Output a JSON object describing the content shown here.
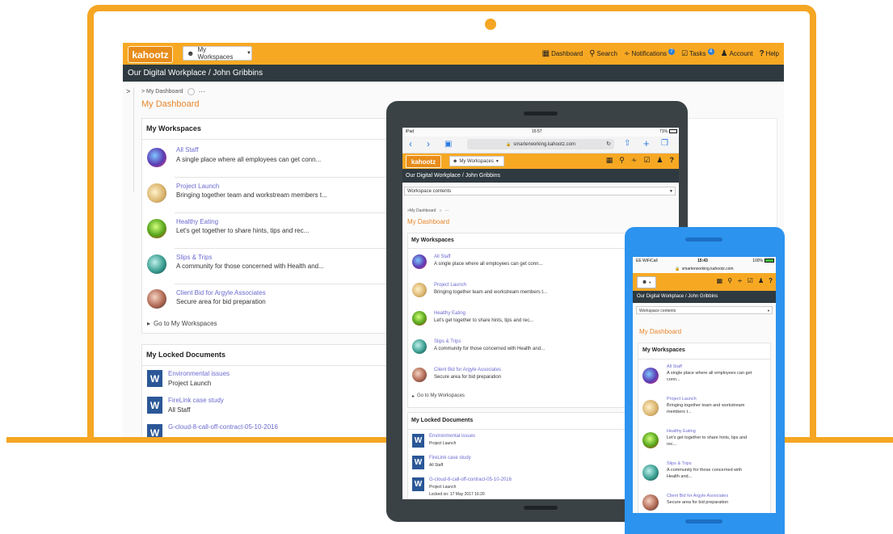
{
  "brand": "kahootz",
  "workspace_selector": "My Workspaces",
  "nav": {
    "dashboard": "Dashboard",
    "search": "Search",
    "notifications": "Notifications",
    "notifications_count": "7",
    "tasks": "Tasks",
    "tasks_count": "4",
    "account": "Account",
    "help": "Help"
  },
  "banner": "Our Digital Workplace / John Gribbins",
  "breadcrumb": "> My Dashboard",
  "page_title": "My Dashboard",
  "sidebar_toggle": ">",
  "workspaces_heading": "My Workspaces",
  "workspaces": [
    {
      "title": "All Staff",
      "desc": "A single place where all employees can get conn..."
    },
    {
      "title": "Project Launch",
      "desc": "Bringing together team and workstream members t..."
    },
    {
      "title": "Healthy Eating",
      "desc": "Let's get together to share hints, tips and rec..."
    },
    {
      "title": "Slips & Trips",
      "desc": "A community for those concerned with Health and..."
    },
    {
      "title": "Client Bid for Argyle Associates",
      "desc": "Secure area for bid preparation"
    }
  ],
  "go_to_workspaces": "Go to My Workspaces",
  "locked_heading": "My Locked Documents",
  "locked_docs": [
    {
      "title": "Environmental issues",
      "ws": "Project Launch"
    },
    {
      "title": "FireLink case study",
      "ws": "All Staff"
    },
    {
      "title": "G-cloud-8-call-off-contract-05-10-2016",
      "ws": "Project Launch"
    }
  ],
  "tablet": {
    "status_left": "iPad",
    "status_time": "15:57",
    "status_battery": "71%",
    "url": "smarterworking.kahootz.com",
    "contents_select": "Workspace contents",
    "breadcrumb": ">My Dashboard",
    "locked_date": "Locked on: 17 May 2017 16:20"
  },
  "phone": {
    "status_carrier": "EE WiFiCall",
    "status_time": "15:43",
    "status_battery": "100%",
    "url": "smarterworking.kahootz.com",
    "contents_select": "Workspace contents",
    "workspaces": [
      {
        "title": "All Staff",
        "desc1": "A single place where all employees can get",
        "desc2": "conn..."
      },
      {
        "title": "Project Launch",
        "desc1": "Bringing together team and workstream",
        "desc2": "members t..."
      },
      {
        "title": "Healthy Eating",
        "desc1": "Let's get together to share hints, tips and",
        "desc2": "rec..."
      },
      {
        "title": "Slips & Trips",
        "desc1": "A community for those concerned with",
        "desc2": "Health and..."
      },
      {
        "title": "Client Bid for Argyle Associates",
        "desc1": "Secure area for bid preparation",
        "desc2": ""
      }
    ]
  },
  "colors": {
    "brand_orange": "#f7a823",
    "banner_dark": "#2f3a40",
    "laptop_frame": "#f5a623",
    "phone_frame": "#2c93ef",
    "tablet_frame": "#3b4246"
  }
}
